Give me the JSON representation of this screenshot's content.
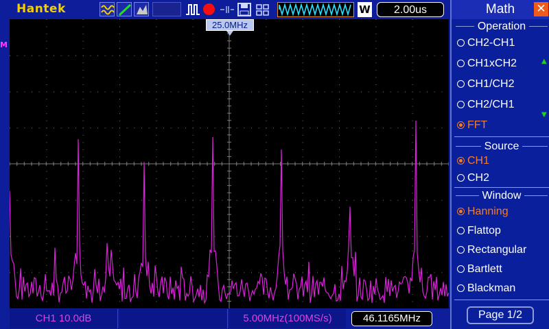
{
  "topbar": {
    "brand": "Hantek",
    "timebase": "2.00us",
    "window_indicator": "W"
  },
  "screen": {
    "math_marker": "M",
    "freq_marker": "25.0MHz",
    "colors": {
      "trace": "#e020e0",
      "grid": "#7a7a7a",
      "background": "#000000"
    }
  },
  "status": {
    "ch1_scale": "CH1 10.0dB",
    "span_rate": "5.00MHz(100MS/s)",
    "counter": "46.1165MHz"
  },
  "menu": {
    "title": "Math",
    "operation": {
      "label": "Operation",
      "options": [
        "CH2-CH1",
        "CH1xCH2",
        "CH1/CH2",
        "CH2/CH1",
        "FFT"
      ],
      "selected": "FFT"
    },
    "source": {
      "label": "Source",
      "options": [
        "CH1",
        "CH2"
      ],
      "selected": "CH1"
    },
    "window": {
      "label": "Window",
      "options": [
        "Hanning",
        "Flattop",
        "Rectangular",
        "Bartlett",
        "Blackman"
      ],
      "selected": "Hanning"
    },
    "page": "Page 1/2"
  }
}
